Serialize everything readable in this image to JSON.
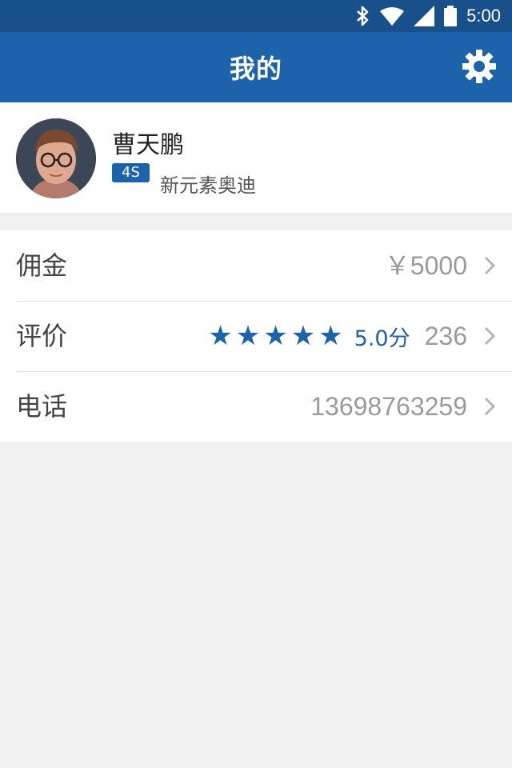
{
  "status_bar": {
    "time": "5:00"
  },
  "header": {
    "title": "我的",
    "settings_icon": "gear-icon"
  },
  "profile": {
    "name": "曹天鹏",
    "badge": "4S",
    "organization": "新元素奥迪"
  },
  "rows": {
    "commission": {
      "label": "佣金",
      "value": "￥5000"
    },
    "rating": {
      "label": "评价",
      "stars": 5,
      "score": "5.0分",
      "count": "236"
    },
    "phone": {
      "label": "电话",
      "value": "13698763259"
    }
  },
  "colors": {
    "primary": "#1c63ab",
    "status_bar": "#17508a",
    "background": "#f1f1f1"
  }
}
